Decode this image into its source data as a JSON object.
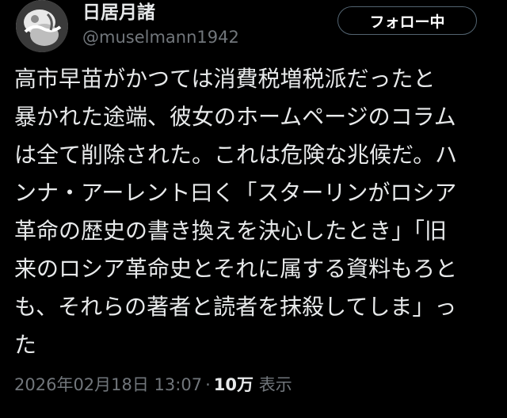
{
  "author": {
    "display_name": "日居月諸",
    "handle": "@muselmann1942",
    "avatar_icon": "avatar-image"
  },
  "follow_button": {
    "label": "フォロー中"
  },
  "tweet": {
    "lines": [
      "高市早苗がかつては消費税増税派だったと",
      "暴かれた途端、彼女のホームページのコラム",
      "は全て削除された。これは危険な兆候だ。ハ",
      "ンナ・アーレント曰く「スターリンがロシア",
      "革命の歴史の書き換えを決心したとき」「旧",
      "来のロシア革命史とそれに属する資料もろと",
      "も、それらの著者と読者を抹殺してしま」っ",
      "た"
    ]
  },
  "meta": {
    "timestamp": "2026年02月18日 13:07",
    "separator": "·",
    "views_count": "10万",
    "views_label": "表示"
  },
  "colors": {
    "background": "#000000",
    "text_primary": "#e7e9ea",
    "text_secondary": "#71767b",
    "button_border": "#536471"
  }
}
